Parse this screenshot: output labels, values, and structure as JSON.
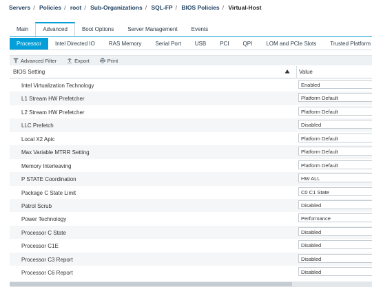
{
  "breadcrumb": {
    "items": [
      "Servers",
      "Policies",
      "root",
      "Sub-Organizations",
      "SQL-FP",
      "BIOS Policies",
      "Virtual-Host"
    ],
    "separator": "/"
  },
  "tabs_primary": [
    "Main",
    "Advanced",
    "Boot Options",
    "Server Management",
    "Events"
  ],
  "tabs_primary_active": "Advanced",
  "tabs_secondary": [
    "Processor",
    "Intel Directed IO",
    "RAS Memory",
    "Serial Port",
    "USB",
    "PCI",
    "QPI",
    "LOM and PCIe Slots",
    "Trusted Platform"
  ],
  "tabs_secondary_active": "Processor",
  "toolbar": {
    "filter_label": "Advanced Filter",
    "export_label": "Export",
    "print_label": "Print"
  },
  "table": {
    "col_setting": "BIOS Setting",
    "col_value": "Value",
    "rows": [
      {
        "setting": "Intel Virtualization Technology",
        "value": "Enabled"
      },
      {
        "setting": "L1 Stream HW Prefetcher",
        "value": "Platform Default"
      },
      {
        "setting": "L2 Stream HW Prefetcher",
        "value": "Platform Default"
      },
      {
        "setting": "LLC Prefetch",
        "value": "Disabled"
      },
      {
        "setting": "Local X2 Apic",
        "value": "Platform Default"
      },
      {
        "setting": "Max Variable MTRR Setting",
        "value": "Platform Default"
      },
      {
        "setting": "Memory Interleaving",
        "value": "Platform Default"
      },
      {
        "setting": "P STATE Coordination",
        "value": "HW ALL"
      },
      {
        "setting": "Package C State Limit",
        "value": "C0 C1 State"
      },
      {
        "setting": "Patrol Scrub",
        "value": "Disabled"
      },
      {
        "setting": "Power Technology",
        "value": "Performance"
      },
      {
        "setting": "Processor C State",
        "value": "Disabled"
      },
      {
        "setting": "Processor C1E",
        "value": "Disabled"
      },
      {
        "setting": "Processor C3 Report",
        "value": "Disabled"
      },
      {
        "setting": "Processor C6 Report",
        "value": "Disabled"
      }
    ]
  },
  "colors": {
    "accent": "#049fd9",
    "breadcrumb": "#1a3b5c"
  }
}
